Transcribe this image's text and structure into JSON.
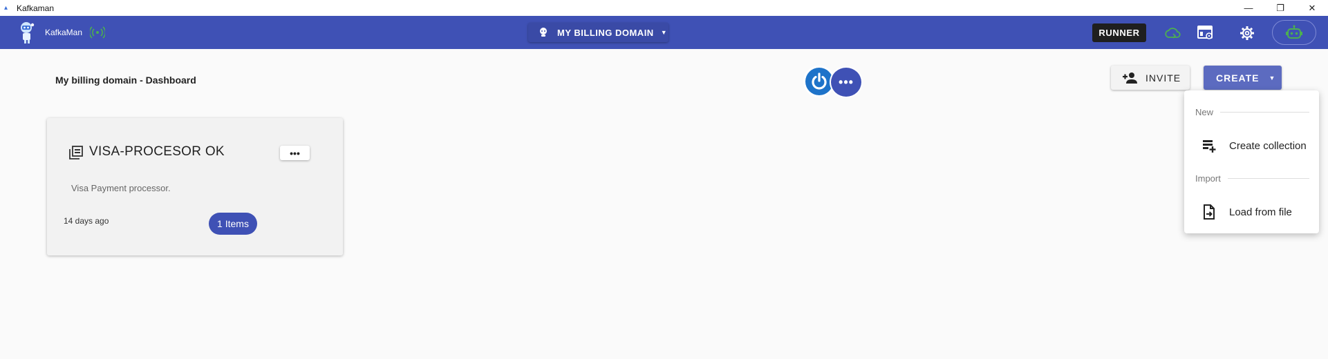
{
  "window": {
    "title": "Kafkaman",
    "controls": {
      "minimize": "—",
      "restore": "❐",
      "close": "✕"
    }
  },
  "appbar": {
    "brand_name": "KafkaMan",
    "domain_label": "MY BILLING DOMAIN",
    "runner_label": "RUNNER",
    "icons": [
      "connection-icon",
      "cloud-sync-icon",
      "dashboard-settings-icon",
      "gear-icon",
      "robot-icon"
    ],
    "accent_color": "#3f51b5",
    "status_color": "#4caf50"
  },
  "main": {
    "page_title": "My billing domain - Dashboard",
    "more_label": "•••",
    "invite_label": "INVITE",
    "create_label": "CREATE"
  },
  "create_menu": {
    "sections": [
      {
        "label": "New",
        "items": [
          {
            "label": "Create collection",
            "icon": "create-collection-icon"
          }
        ]
      },
      {
        "label": "Import",
        "items": [
          {
            "label": "Load from file",
            "icon": "load-file-icon"
          }
        ]
      }
    ]
  },
  "collections": [
    {
      "title": "VISA-PROCESOR OK",
      "description": "Visa Payment processor.",
      "updated": "14 days ago",
      "items_badge": "1 Items",
      "more_label": "•••"
    }
  ]
}
